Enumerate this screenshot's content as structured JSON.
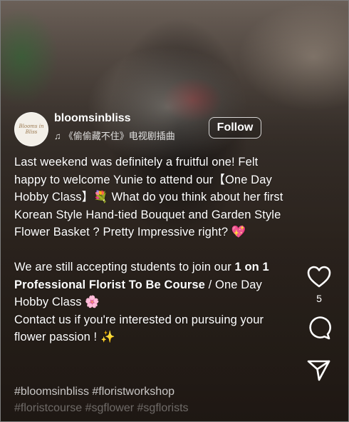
{
  "post": {
    "username": "bloomsinbliss",
    "music_note_icon": "music-note-icon",
    "music": "《偷偷藏不住》电视剧插曲",
    "follow_label": "Follow",
    "avatar_text": "Blooms in Bliss"
  },
  "caption": {
    "line1": "Last weekend was definitely a fruitful one! Felt happy to welcome Yunie to attend our【One Day Hobby Class】",
    "line1_emoji": "💐",
    "line1_rest": " What do you think about her first Korean Style Hand-tied Bouquet and Garden Style Flower Basket ? Pretty Impressive right? ",
    "line1_end_emoji": "💖",
    "p2_pre": "We are still accepting students to join our ",
    "p2_bold": "1 on 1 Professional Florist To Be Course",
    "p2_post": " / One Day Hobby Class ",
    "p2_emoji": "🌸",
    "p3": "Contact us if you're interested on pursuing your flower passion ! ",
    "p3_emoji": "✨"
  },
  "hashtags": {
    "line1": "#bloomsinbliss #floristworkshop",
    "line2": "#floristcourse #sgflower #sgflorists"
  },
  "actions": {
    "like_count": "5"
  },
  "colors": {
    "text": "#ffffff",
    "hashtag": "#bfbfbf"
  }
}
